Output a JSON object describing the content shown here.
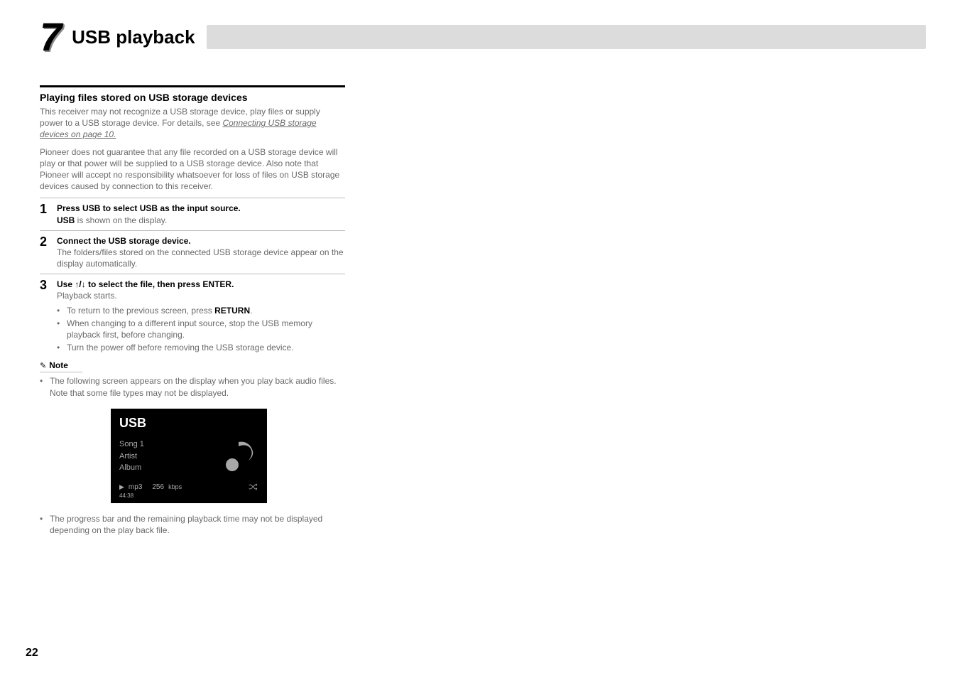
{
  "chapter": {
    "num": "7",
    "title": "USB playback"
  },
  "section": {
    "title": "Playing files stored on USB storage devices",
    "intro1": "This receiver may not recognize a USB storage device, play files or supply power to a USB storage device. For details, see ",
    "intro1_link": "Connecting USB storage devices",
    "intro1_suffix": " on page 10.",
    "intro2": "Pioneer does not guarantee that any file recorded on a USB storage device will play or that power will be supplied to a USB storage device. Also note that Pioneer will accept no responsibility whatsoever for loss of files on USB storage devices caused by connection to this receiver."
  },
  "steps": [
    {
      "num": "1",
      "title": "Press USB to select USB as the input source.",
      "sub_html": "<b>USB</b> is shown on the display."
    },
    {
      "num": "2",
      "title": "Connect the USB storage device.",
      "sub_html": "The folders/files stored on the connected USB storage device appear on the display automatically."
    },
    {
      "num": "3",
      "title_pre": "Use ",
      "title_arrows": "↑/↓",
      "title_post": " to select the file, then press ENTER.",
      "sub_html": "Playback starts.",
      "bullets": [
        {
          "pre": "To return to the previous screen, press ",
          "bold": "RETURN",
          "post": "."
        },
        {
          "pre": "When changing to a different input source, stop the USB memory playback first, before changing.",
          "bold": "",
          "post": ""
        },
        {
          "pre": "Turn the power off before removing the USB storage device.",
          "bold": "",
          "post": ""
        }
      ]
    }
  ],
  "note": {
    "label": "Note",
    "bullet1": "The following screen appears on the display when you play back audio files. Note that some file types may not be displayed.",
    "bullet2": "The progress bar and the remaining playback time may not be displayed depending on the play back file."
  },
  "display": {
    "header": "USB",
    "line1": "Song 1",
    "line2": "Artist",
    "line3": "Album",
    "format": "mp3",
    "bitrate": "256",
    "bitrate_unit": "kbps",
    "time": "44:38"
  },
  "page_num": "22"
}
